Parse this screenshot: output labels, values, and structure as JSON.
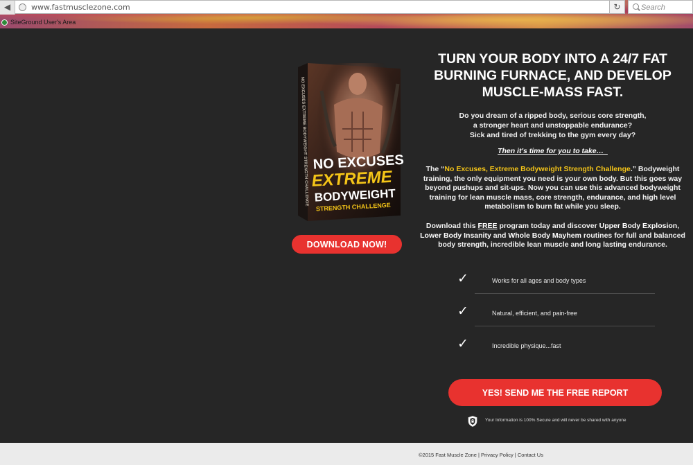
{
  "browser": {
    "back_glyph": "◀",
    "url": "www.fastmusclezone.com",
    "reload_glyph": "↻",
    "search_placeholder": "Search",
    "bookmark_label": "SiteGround User's Area",
    "icons": [
      "back-arrow-icon",
      "globe-icon",
      "reload-icon",
      "search-icon",
      "siteground-icon"
    ]
  },
  "book": {
    "title_line1": "NO EXCUSES",
    "title_line2": "EXTREME",
    "title_line3": "BODYWEIGHT",
    "title_line4": "STRENGTH CHALLENGE",
    "spine_text": "NO EXCUSES EXTREME BODYWEIGHT STRENGTH CHALLENGE",
    "accent_color": "#f5c518"
  },
  "download_button": "DOWNLOAD NOW!",
  "headline": "TURN YOUR BODY INTO A 24/7 FAT\nBURNING FURNACE, AND DEVELOP\nMUSCLE-MASS   FAST.",
  "intro": "Do you dream of a ripped body, serious core strength,\na stronger heart and unstoppable endurance?\nSick and tired of trekking to the gym every day?",
  "then": "Then it's time for you to take…  ",
  "challenge_para": {
    "prefix": "The “",
    "product": "No Excuses, Extreme Bodyweight Strength Challenge",
    "suffix": ".”",
    "body": " Bodyweight training, the only equipment you need is your own body. But this goes way beyond pushups and sit-ups. Now you can use this advanced bodyweight training for lean muscle mass, core strength, endurance, and high level metabolism to burn fat while you sleep."
  },
  "download_para": {
    "part1": "Download this ",
    "free": "FREE",
    "part2": " program today and discover ",
    "bold1": "Upper Body Explosion",
    "sep1": ", ",
    "bold2": "Lower Body Insanity",
    "part3": " and ",
    "bold3": "Whole Body Mayhem",
    "part4": " routines for full and balanced body strength, incredible lean muscle and long lasting endurance."
  },
  "bullets": [
    {
      "icon": "checkmark-icon",
      "glyph": "✓",
      "text": "Works for all ages and body types"
    },
    {
      "icon": "checkmark-icon",
      "glyph": "✓",
      "text": "Natural, efficient, and pain-free"
    },
    {
      "icon": "checkmark-icon",
      "glyph": "✓",
      "text": "Incredible physique...fast"
    }
  ],
  "cta_button": "YES! SEND ME THE FREE REPORT",
  "secure_text": "Your Information is 100% Secure and will never be shared with anyone",
  "footer": {
    "copyright": "©2015 Fast Muscle Zone",
    "sep": " | ",
    "privacy": "Privacy Policy",
    "contact": "Contact Us"
  },
  "colors": {
    "background": "#262626",
    "button_red": "#e8322f",
    "highlight_yellow": "#f5c518",
    "footer_bg": "#ebebeb"
  }
}
